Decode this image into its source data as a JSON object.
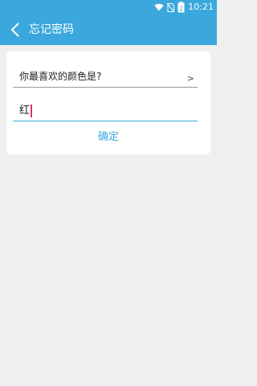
{
  "status_bar": {
    "time": "10:21",
    "battery": "2",
    "icons": [
      "wifi-icon",
      "no-sim-icon",
      "battery-icon"
    ]
  },
  "app_bar": {
    "title": "忘记密码",
    "back_icon": "chevron-left-icon"
  },
  "form": {
    "question": "你最喜欢的颜色是?",
    "question_arrow": ">",
    "answer_value": "红",
    "confirm_label": "确定"
  },
  "colors": {
    "primary": "#3aa8dc",
    "background": "#efefef",
    "card": "#ffffff",
    "caret": "#e0306a"
  }
}
